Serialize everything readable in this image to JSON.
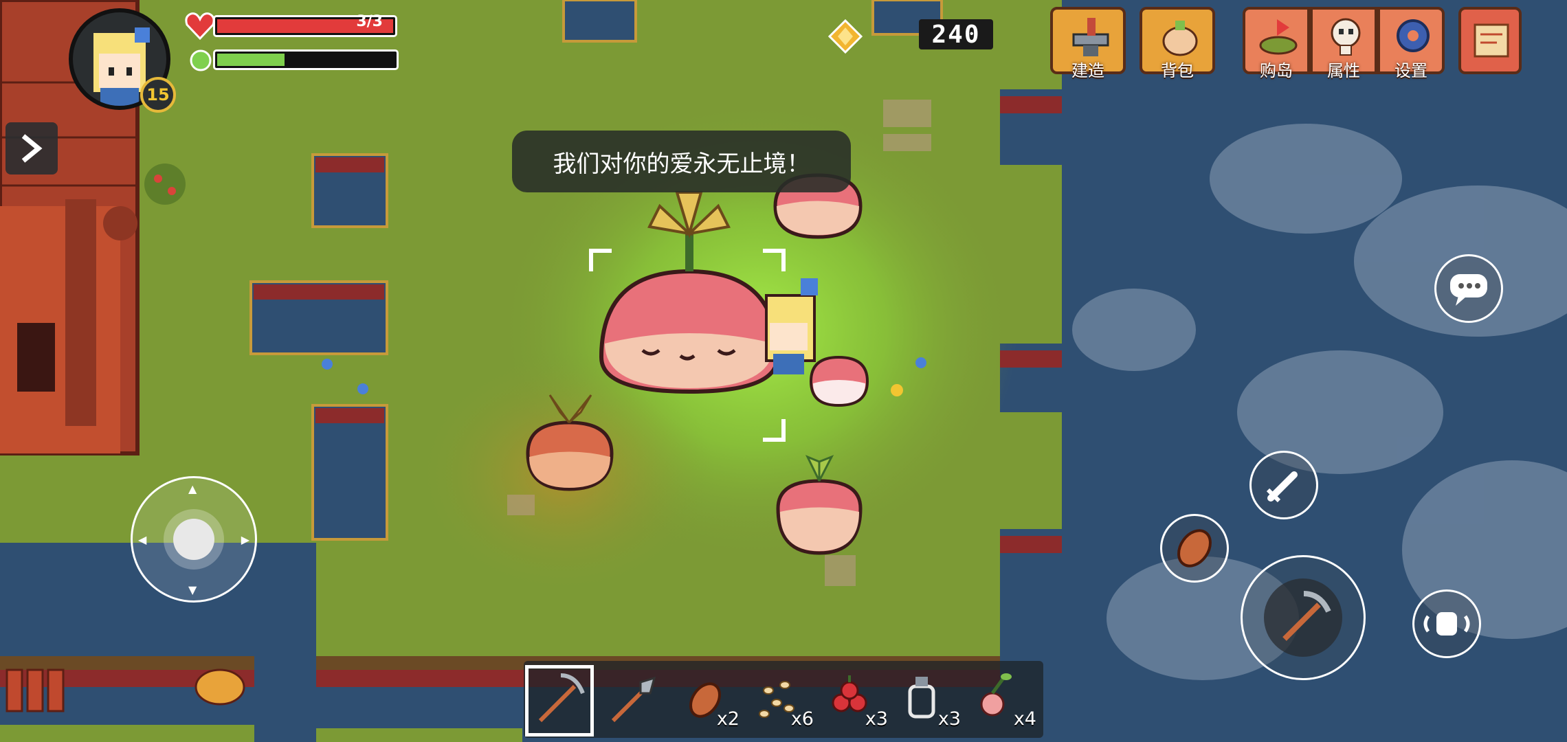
{
  "player": {
    "level": "15",
    "hp_text": "3/3",
    "hp_fraction": 1.0,
    "energy_fraction": 0.38
  },
  "currency": {
    "coins": "240"
  },
  "dialog": {
    "text": "我们对你的爱永无止境！"
  },
  "top_menu": {
    "build": "建造",
    "backpack": "背包",
    "buy_island": "购岛",
    "attributes": "属性",
    "settings": "设置"
  },
  "hotbar": {
    "items": [
      {
        "icon": "pickaxe-icon",
        "count": ""
      },
      {
        "icon": "shovel-icon",
        "count": ""
      },
      {
        "icon": "meat-icon",
        "count": "x2"
      },
      {
        "icon": "seeds-icon",
        "count": "x6"
      },
      {
        "icon": "berries-icon",
        "count": "x3"
      },
      {
        "icon": "bottle-icon",
        "count": "x3"
      },
      {
        "icon": "beet-icon",
        "count": "x4"
      }
    ],
    "selected_index": 0
  },
  "colors": {
    "grass": "#7c9a35",
    "water": "#2f4f72",
    "hp": "#e23b3b",
    "energy": "#7fd04d"
  }
}
